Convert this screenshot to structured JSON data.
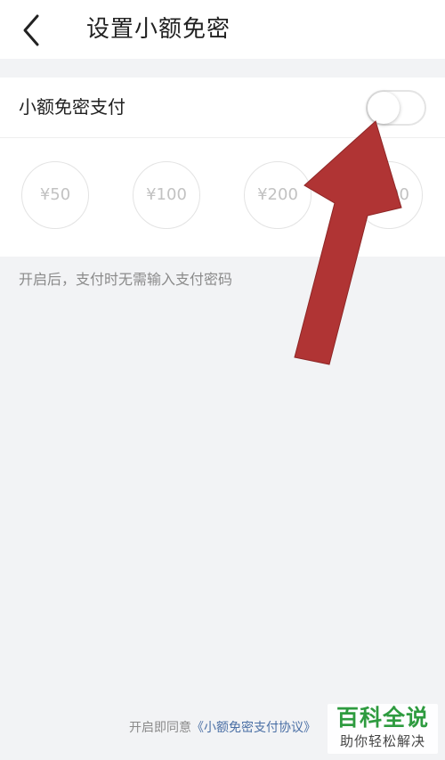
{
  "header": {
    "title": "设置小额免密",
    "back_icon": "chevron-left-icon"
  },
  "setting": {
    "label": "小额免密支付",
    "enabled": false
  },
  "amounts": [
    "¥50",
    "¥100",
    "¥200",
    "¥500"
  ],
  "note": "开启后，支付时无需输入支付密码",
  "footer": {
    "prefix": "开启即同意",
    "link": "《小额免密支付协议》"
  },
  "watermark": {
    "main": "百科全说",
    "sub": "助你轻松解决"
  },
  "colors": {
    "background": "#f2f3f5",
    "link": "#4a6fa5",
    "arrow": "#b03434",
    "watermark": "#2e9b3f"
  }
}
